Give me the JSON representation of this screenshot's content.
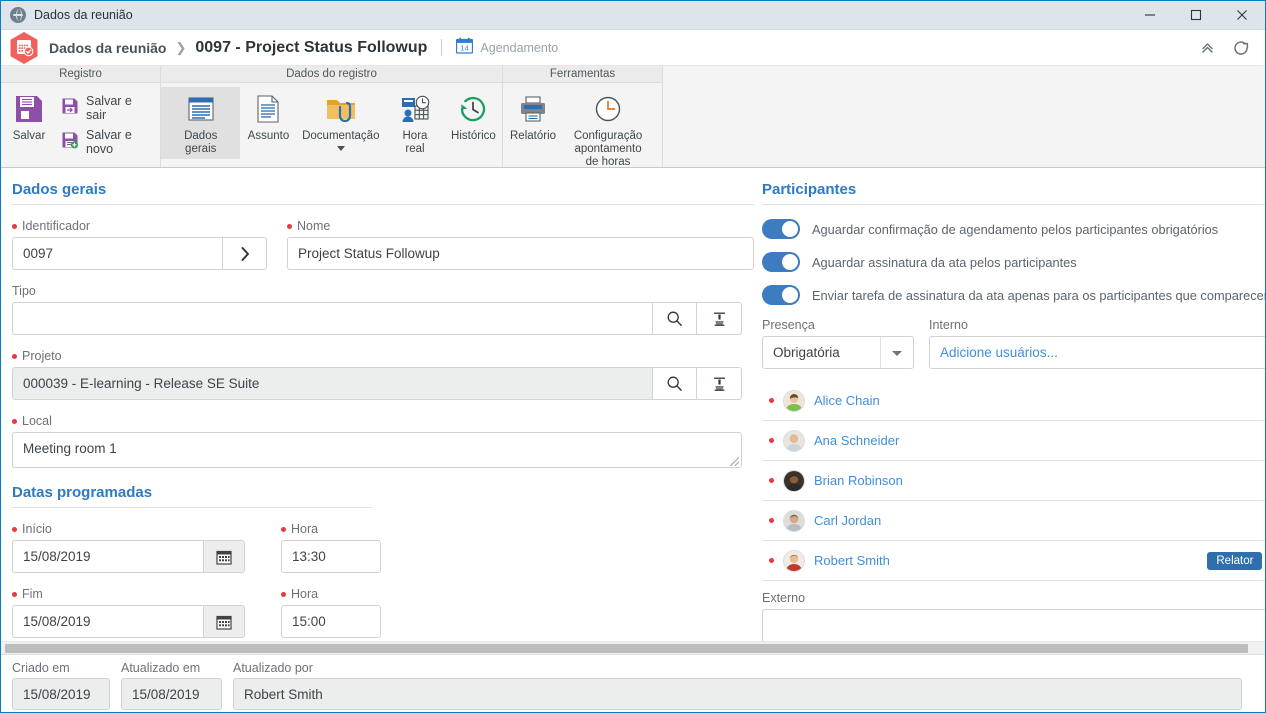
{
  "window": {
    "title": "Dados da reunião",
    "app_icon": "globe-icon",
    "minimize_label": "Minimizar",
    "maximize_label": "Maximizar",
    "close_label": "Fechar"
  },
  "breadcrumb": {
    "icon": "calendar-check-hex-icon",
    "root": "Dados da reunião",
    "separator": "❯",
    "current": "0097 - Project Status Followup",
    "schedule_icon": "calendar-14-icon",
    "schedule_label": "Agendamento",
    "collapse_icon": "chevron-double-up-icon",
    "refresh_icon": "refresh-icon"
  },
  "ribbon": {
    "groups": [
      {
        "title": "Registro",
        "big": [
          {
            "label": "Salvar",
            "icon": "save-floppy-icon",
            "selected": false
          }
        ],
        "small": [
          {
            "label": "Salvar e sair",
            "icon": "save-exit-icon"
          },
          {
            "label": "Salvar e novo",
            "icon": "save-new-icon"
          }
        ]
      },
      {
        "title": "Dados do registro",
        "big": [
          {
            "label": "Dados gerais",
            "icon": "general-data-icon",
            "selected": true
          },
          {
            "label": "Assunto",
            "icon": "subject-document-icon",
            "selected": false
          },
          {
            "label": "Documentação",
            "icon": "folder-paperclip-icon",
            "selected": false,
            "has_caret": true
          },
          {
            "label": "Hora real",
            "icon": "real-time-icon",
            "selected": false
          },
          {
            "label": "Histórico",
            "icon": "history-clock-icon",
            "selected": false
          }
        ],
        "small": []
      },
      {
        "title": "Ferramentas",
        "big": [
          {
            "label": "Relatório",
            "icon": "printer-icon",
            "selected": false
          },
          {
            "label": "Configuração apontamento de horas",
            "icon": "clock-config-icon",
            "selected": false
          }
        ],
        "small": []
      }
    ]
  },
  "general": {
    "title": "Dados gerais",
    "identificador_label": "Identificador",
    "identificador_value": "0097",
    "identificador_btn_icon": "chevron-right-icon",
    "nome_label": "Nome",
    "nome_value": "Project Status Followup",
    "tipo_label": "Tipo",
    "tipo_value": "",
    "projeto_label": "Projeto",
    "projeto_value": "000039 - E-learning - Release SE Suite",
    "local_label": "Local",
    "local_value": "Meeting room 1",
    "search_icon": "magnifier-icon",
    "clear_icon": "eraser-brush-icon"
  },
  "dates": {
    "title": "Datas programadas",
    "inicio_label": "Início",
    "inicio_value": "15/08/2019",
    "inicio_hora_label": "Hora",
    "inicio_hora_value": "13:30",
    "fim_label": "Fim",
    "fim_value": "15/08/2019",
    "fim_hora_label": "Hora",
    "fim_hora_value": "15:00",
    "calendar_icon": "calendar-icon"
  },
  "participants": {
    "title": "Participantes",
    "toggles": [
      {
        "label": "Aguardar confirmação de agendamento pelos participantes obrigatórios",
        "on": true
      },
      {
        "label": "Aguardar assinatura da ata pelos participantes",
        "on": true
      },
      {
        "label": "Enviar tarefa de assinatura da ata apenas para os participantes que compareceram à",
        "on": true
      }
    ],
    "presenca_label": "Presença",
    "presenca_value": "Obrigatória",
    "interno_label": "Interno",
    "interno_placeholder": "Adicione usuários...",
    "list": [
      {
        "name": "Alice Chain",
        "tag": "",
        "avatar_color": "#7bbf4c"
      },
      {
        "name": "Ana Schneider",
        "tag": "",
        "avatar_color": "#d9b38c"
      },
      {
        "name": "Brian Robinson",
        "tag": "",
        "avatar_color": "#4c4038"
      },
      {
        "name": "Carl Jordan",
        "tag": "",
        "avatar_color": "#c9c4bd"
      },
      {
        "name": "Robert Smith",
        "tag": "Relator",
        "avatar_color": "#c0392b"
      }
    ],
    "remove_icon": "close-x-icon",
    "externo_label": "Externo",
    "externo_value": ""
  },
  "footer": {
    "criado_label": "Criado em",
    "criado_value": "15/08/2019",
    "atualizado_label": "Atualizado em",
    "atualizado_value": "15/08/2019",
    "atualizado_por_label": "Atualizado por",
    "atualizado_por_value": "Robert Smith"
  },
  "colors": {
    "accent": "#2d7bc4",
    "required": "#e8393e",
    "link": "#3f8fdc",
    "toggle_on": "#3c7cbf",
    "tag": "#2f6fae",
    "titlebar": "#dde4ea",
    "window_border": "#0a7cc1"
  }
}
